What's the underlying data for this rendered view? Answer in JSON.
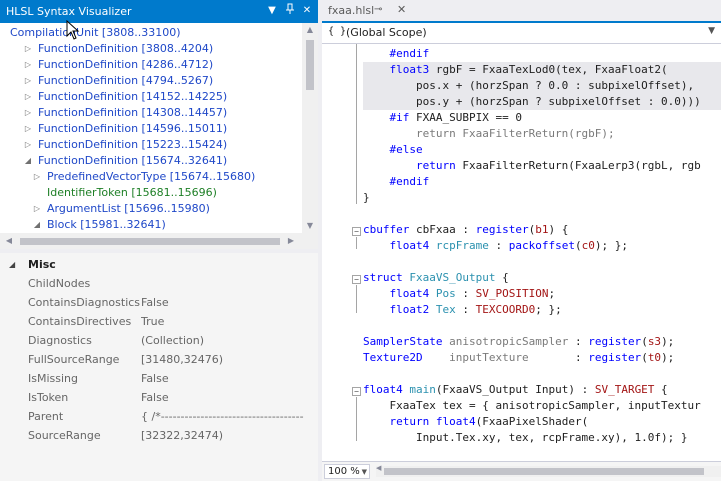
{
  "tool_window": {
    "title": "HLSL Syntax Visualizer",
    "buttons": [
      "dropdown-icon",
      "pin-icon",
      "close-icon"
    ]
  },
  "tree": {
    "nodes": [
      {
        "label": "CompilationUnit [3808..33100)",
        "depth": 0,
        "arrow": "",
        "color": "blue"
      },
      {
        "label": "FunctionDefinition [3808..4204)",
        "depth": 1,
        "arrow": "collapsed",
        "color": "blue"
      },
      {
        "label": "FunctionDefinition [4286..4712)",
        "depth": 1,
        "arrow": "collapsed",
        "color": "blue"
      },
      {
        "label": "FunctionDefinition [4794..5267)",
        "depth": 1,
        "arrow": "collapsed",
        "color": "blue"
      },
      {
        "label": "FunctionDefinition [14152..14225)",
        "depth": 1,
        "arrow": "collapsed",
        "color": "blue"
      },
      {
        "label": "FunctionDefinition [14308..14457)",
        "depth": 1,
        "arrow": "collapsed",
        "color": "blue"
      },
      {
        "label": "FunctionDefinition [14596..15011)",
        "depth": 1,
        "arrow": "collapsed",
        "color": "blue"
      },
      {
        "label": "FunctionDefinition [15223..15424)",
        "depth": 1,
        "arrow": "collapsed",
        "color": "blue"
      },
      {
        "label": "FunctionDefinition [15674..32641)",
        "depth": 1,
        "arrow": "expanded",
        "color": "blue"
      },
      {
        "label": "PredefinedVectorType [15674..15680)",
        "depth": 2,
        "arrow": "collapsed",
        "color": "blue"
      },
      {
        "label": "IdentifierToken [15681..15696)",
        "depth": 2,
        "arrow": "",
        "color": "green"
      },
      {
        "label": "ArgumentList [15696..15980)",
        "depth": 2,
        "arrow": "collapsed",
        "color": "blue"
      },
      {
        "label": "Block [15981..32641)",
        "depth": 2,
        "arrow": "expanded",
        "color": "blue"
      }
    ]
  },
  "properties": {
    "category": "Misc",
    "rows": [
      {
        "name": "ChildNodes",
        "value": ""
      },
      {
        "name": "ContainsDiagnostics",
        "value": "False"
      },
      {
        "name": "ContainsDirectives",
        "value": "True"
      },
      {
        "name": "Diagnostics",
        "value": "(Collection)"
      },
      {
        "name": "FullSourceRange",
        "value": "[31480,32476)"
      },
      {
        "name": "IsMissing",
        "value": "False"
      },
      {
        "name": "IsToken",
        "value": "False"
      },
      {
        "name": "Parent",
        "value": "{    /*------------------------------------"
      },
      {
        "name": "SourceRange",
        "value": "[32322,32474)"
      }
    ]
  },
  "editor": {
    "tab_label": "fxaa.hlsl",
    "scope_icon": "{ }",
    "scope_label": "(Global Scope)",
    "zoom": "100 %",
    "code_lines": [
      [
        [
          "kw",
          "    #endif"
        ]
      ],
      [
        [
          "kw",
          "    float3"
        ],
        [
          "id",
          " rgbF = FxaaTexLod0(tex, FxaaFloat2("
        ]
      ],
      [
        [
          "id",
          "        pos.x + (horzSpan ? 0.0 : subpixelOffset),"
        ]
      ],
      [
        [
          "id",
          "        pos.y + (horzSpan ? subpixelOffset : 0.0)))"
        ]
      ],
      [
        [
          "kw",
          "    #if"
        ],
        [
          "id",
          " FXAA_SUBPIX == 0"
        ]
      ],
      [
        [
          "grey",
          "        return FxaaFilterReturn(rgbF);"
        ]
      ],
      [
        [
          "kw",
          "    #else"
        ]
      ],
      [
        [
          "kw",
          "        return"
        ],
        [
          "id",
          " FxaaFilterReturn(FxaaLerp3(rgbL, rgb"
        ]
      ],
      [
        [
          "kw",
          "    #endif"
        ]
      ],
      [
        [
          "id",
          "}"
        ]
      ],
      [
        [
          "id",
          ""
        ]
      ],
      [
        [
          "kw",
          "cbuffer"
        ],
        [
          "id",
          " cbFxaa : "
        ],
        [
          "kw",
          "register"
        ],
        [
          "id",
          "("
        ],
        [
          "str",
          "b1"
        ],
        [
          "id",
          ") {"
        ]
      ],
      [
        [
          "kw",
          "    float4"
        ],
        [
          "id",
          " "
        ],
        [
          "ty",
          "rcpFrame"
        ],
        [
          "id",
          " : "
        ],
        [
          "kw",
          "packoffset"
        ],
        [
          "id",
          "("
        ],
        [
          "str",
          "c0"
        ],
        [
          "id",
          "); };"
        ]
      ],
      [
        [
          "id",
          ""
        ]
      ],
      [
        [
          "kw",
          "struct"
        ],
        [
          "id",
          " "
        ],
        [
          "ty",
          "FxaaVS_Output"
        ],
        [
          "id",
          " {"
        ]
      ],
      [
        [
          "kw",
          "    float4"
        ],
        [
          "id",
          " "
        ],
        [
          "ty",
          "Pos"
        ],
        [
          "id",
          " : "
        ],
        [
          "sem",
          "SV_POSITION"
        ],
        [
          "id",
          ";"
        ]
      ],
      [
        [
          "kw",
          "    float2"
        ],
        [
          "id",
          " "
        ],
        [
          "ty",
          "Tex"
        ],
        [
          "id",
          " : "
        ],
        [
          "sem",
          "TEXCOORD0"
        ],
        [
          "id",
          "; };"
        ]
      ],
      [
        [
          "id",
          ""
        ]
      ],
      [
        [
          "kw",
          "SamplerState"
        ],
        [
          "id",
          " "
        ],
        [
          "grey",
          "anisotropicSampler"
        ],
        [
          "id",
          " : "
        ],
        [
          "kw",
          "register"
        ],
        [
          "id",
          "("
        ],
        [
          "str",
          "s3"
        ],
        [
          "id",
          ");"
        ]
      ],
      [
        [
          "kw",
          "Texture2D"
        ],
        [
          "id",
          "    "
        ],
        [
          "grey",
          "inputTexture"
        ],
        [
          "id",
          "       : "
        ],
        [
          "kw",
          "register"
        ],
        [
          "id",
          "("
        ],
        [
          "str",
          "t0"
        ],
        [
          "id",
          ");"
        ]
      ],
      [
        [
          "id",
          ""
        ]
      ],
      [
        [
          "kw",
          "float4"
        ],
        [
          "id",
          " "
        ],
        [
          "ty",
          "main"
        ],
        [
          "id",
          "(FxaaVS_Output Input) : "
        ],
        [
          "sem",
          "SV_TARGET"
        ],
        [
          "id",
          " {"
        ]
      ],
      [
        [
          "id",
          "    FxaaTex tex = { anisotropicSampler, inputTextur"
        ]
      ],
      [
        [
          "kw",
          "    return"
        ],
        [
          "id",
          " "
        ],
        [
          "kw",
          "float4"
        ],
        [
          "id",
          "(FxaaPixelShader("
        ]
      ],
      [
        [
          "id",
          "        Input.Tex.xy, tex, rcpFrame.xy), 1.0f); }"
        ]
      ]
    ]
  }
}
